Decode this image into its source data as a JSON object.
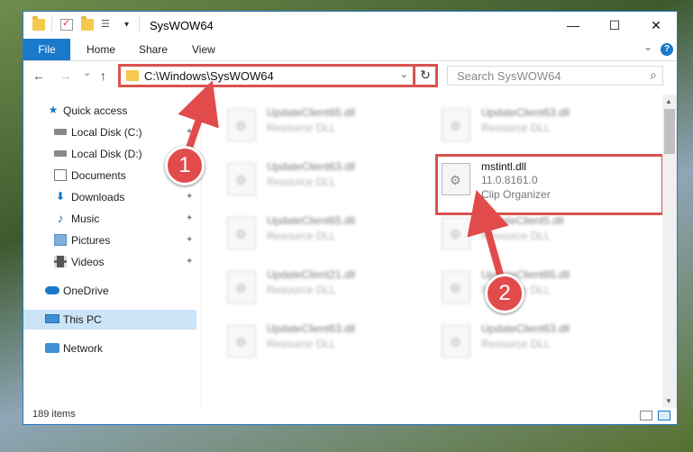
{
  "window": {
    "title": "SysWOW64",
    "minimize_glyph": "—",
    "maximize_glyph": "☐",
    "close_glyph": "✕"
  },
  "ribbon": {
    "tabs": [
      "File",
      "Home",
      "Share",
      "View"
    ],
    "expand_glyph": "⌄",
    "help_glyph": "?"
  },
  "nav": {
    "back_glyph": "←",
    "forward_glyph": "→",
    "recent_glyph": "⌄",
    "up_glyph": "↑",
    "address": "C:\\Windows\\SysWOW64",
    "address_dropdown_glyph": "⌄",
    "refresh_glyph": "↻",
    "search_placeholder": "Search SysWOW64",
    "search_glyph": "⌕"
  },
  "sidebar": {
    "items": [
      {
        "label": "Quick access",
        "icon": "star-icon"
      },
      {
        "label": "Local Disk (C:)",
        "icon": "drive-icon"
      },
      {
        "label": "Local Disk (D:)",
        "icon": "drive-icon"
      },
      {
        "label": "Documents",
        "icon": "documents-icon"
      },
      {
        "label": "Downloads",
        "icon": "download-icon"
      },
      {
        "label": "Music",
        "icon": "music-icon"
      },
      {
        "label": "Pictures",
        "icon": "pictures-icon"
      },
      {
        "label": "Videos",
        "icon": "videos-icon"
      },
      {
        "label": "OneDrive",
        "icon": "cloud-icon"
      },
      {
        "label": "This PC",
        "icon": "computer-icon"
      },
      {
        "label": "Network",
        "icon": "network-icon"
      }
    ]
  },
  "files": [
    {
      "name": "UpdateClient65.dll",
      "type": "Resource DLL"
    },
    {
      "name": "UpdateClient63.dll",
      "type": "Resource DLL"
    },
    {
      "name": "UpdateClient63.dll",
      "type": "Resource DLL"
    },
    {
      "name": "mstintl.dll",
      "version": "11.0.8161.0",
      "description": "Clip Organizer"
    },
    {
      "name": "UpdateClient65.dll",
      "type": "Resource DLL"
    },
    {
      "name": "UpdateClient5.dll",
      "type": "Resource DLL"
    },
    {
      "name": "UpdateClient21.dll",
      "type": "Resource DLL"
    },
    {
      "name": "UpdateClient65.dll",
      "type": "Resource DLL"
    },
    {
      "name": "UpdateClient63.dll",
      "type": "Resource DLL"
    },
    {
      "name": "UpdateClient63.dll",
      "type": "Resource DLL"
    }
  ],
  "status": {
    "item_count": "189 items"
  },
  "callouts": [
    "1",
    "2"
  ],
  "colors": {
    "accent": "#1979ca",
    "highlight": "#d9534f",
    "selected": "#cce4f7"
  }
}
